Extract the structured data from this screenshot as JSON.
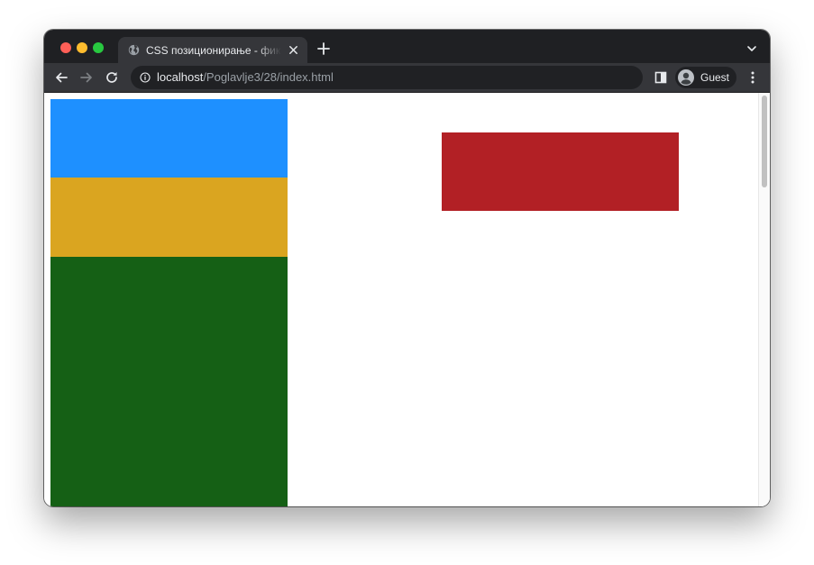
{
  "browser": {
    "tab": {
      "title": "CSS позиционирање - фиксно позиционирање",
      "favicon": "globe-icon",
      "close_icon": "close-icon"
    },
    "new_tab_icon": "plus-icon",
    "tab_search_icon": "chevron-down-icon",
    "toolbar": {
      "back_icon": "arrow-left-icon",
      "forward_icon": "arrow-right-icon",
      "reload_icon": "reload-icon",
      "site_info_icon": "info-icon",
      "side_panel_icon": "side-panel-icon",
      "menu_icon": "kebab-menu-icon"
    },
    "address": {
      "host": "localhost",
      "path": "/Poglavlje3/28/index.html"
    },
    "profile": {
      "label": "Guest",
      "icon": "account-icon"
    }
  },
  "page": {
    "boxes": [
      {
        "name": "blue-box",
        "color": "#1e90ff"
      },
      {
        "name": "gold-box",
        "color": "#daa520"
      },
      {
        "name": "green-box",
        "color": "#156015"
      },
      {
        "name": "red-box",
        "color": "#b22025"
      }
    ]
  },
  "colors": {
    "tabbar_bg": "#1f2023",
    "toolbar_bg": "#35363a",
    "omnibox_bg": "#202124",
    "scroll_thumb": "#c1c1c1"
  }
}
